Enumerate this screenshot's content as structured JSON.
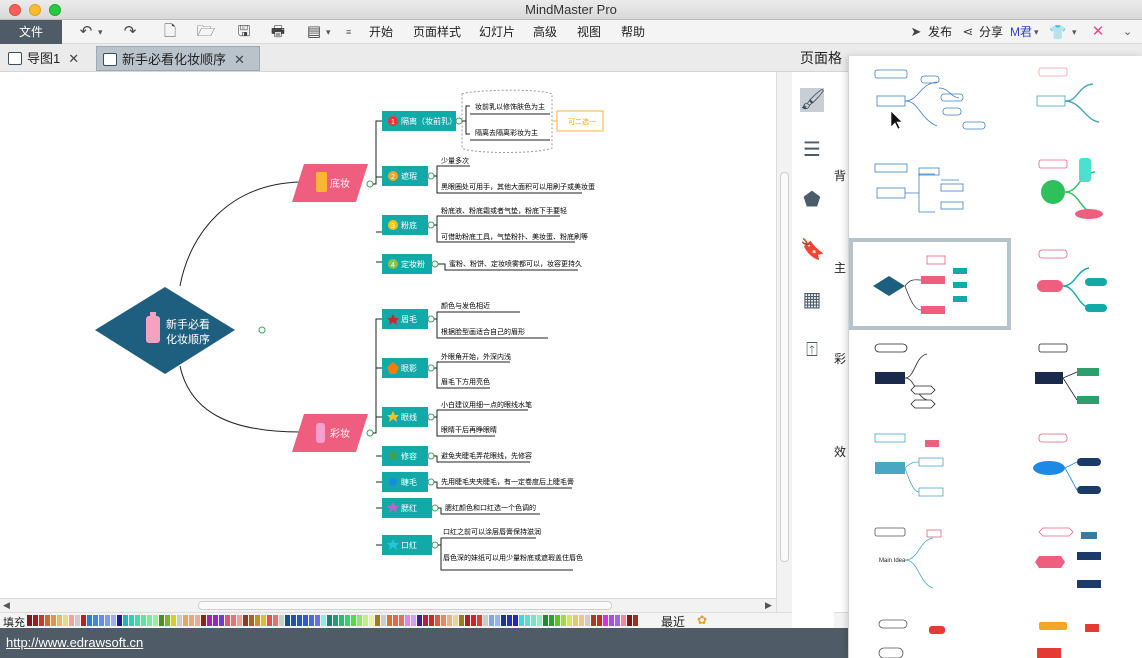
{
  "window": {
    "title": "MindMaster Pro"
  },
  "menubar": {
    "file": "文件",
    "items": [
      "开始",
      "页面样式",
      "幻灯片",
      "高级",
      "视图",
      "帮助"
    ],
    "publish": "发布",
    "share": "分享",
    "user": "M君"
  },
  "tabs": [
    {
      "label": "导图1",
      "active": false
    },
    {
      "label": "新手必看化妆顺序",
      "active": true
    }
  ],
  "mindmap": {
    "central": [
      "新手必看",
      "化妆顺序"
    ],
    "branches": [
      {
        "label": "底妆",
        "topics": [
          {
            "num": "1",
            "label": "隔离（妆前乳）",
            "subs": [
              "妆前乳以修饰肤色为主",
              "隔离去隔离彩妆为主"
            ],
            "note": "可二选一"
          },
          {
            "num": "2",
            "label": "遮瑕",
            "subs": [
              "少量多次",
              "黑眼圈处可用手，其他大面积可以用刷子或美妆蛋"
            ]
          },
          {
            "num": "3",
            "label": "粉底",
            "subs": [
              "粉底液、粉底霜或者气垫，粉底下手要轻",
              "可借助粉底工具，气垫粉扑、美妆蛋、粉底刷等"
            ]
          },
          {
            "num": "4",
            "label": "定妆粉",
            "subs": [
              "蜜粉、粉饼、定妆喷雾都可以，妆容更持久"
            ]
          }
        ]
      },
      {
        "label": "彩妆",
        "topics": [
          {
            "label": "眉毛",
            "subs": [
              "颜色与发色相近",
              "根据脸型画适合自己的眉形"
            ]
          },
          {
            "label": "眼影",
            "subs": [
              "外眼角开始，外深内浅",
              "眉毛下方用亮色"
            ]
          },
          {
            "label": "眼线",
            "subs": [
              "小白建议用细一点的眼线水笔",
              "眼睛干后再睁眼睛"
            ]
          },
          {
            "label": "修容",
            "subs": [
              "避免夹睫毛弄花眼线，先修容"
            ]
          },
          {
            "label": "睫毛",
            "subs": [
              "先用睫毛夹夹睫毛，有一定卷度后上睫毛膏"
            ]
          },
          {
            "label": "腮红",
            "subs": [
              "腮红颜色和口红选一个色调的"
            ]
          },
          {
            "label": "口红",
            "subs": [
              "口红之前可以涂层唇膏保持滋润",
              "唇色深的妹纸可以用少量粉底或遮瑕盖住唇色"
            ]
          }
        ]
      }
    ]
  },
  "palette": {
    "fill_label": "填充",
    "recent_label": "最近"
  },
  "status": {
    "url": "http://www.edrawsoft.cn"
  },
  "side_panel": {
    "heading": "页面格",
    "labels": [
      "背",
      "主",
      "彩",
      "效"
    ]
  },
  "colors": {
    "accent_dark": "#4f5b66",
    "central_fill": "#1e5f7f",
    "branch_pink": "#f05e7f",
    "topic_teal": "#12a9a9"
  }
}
